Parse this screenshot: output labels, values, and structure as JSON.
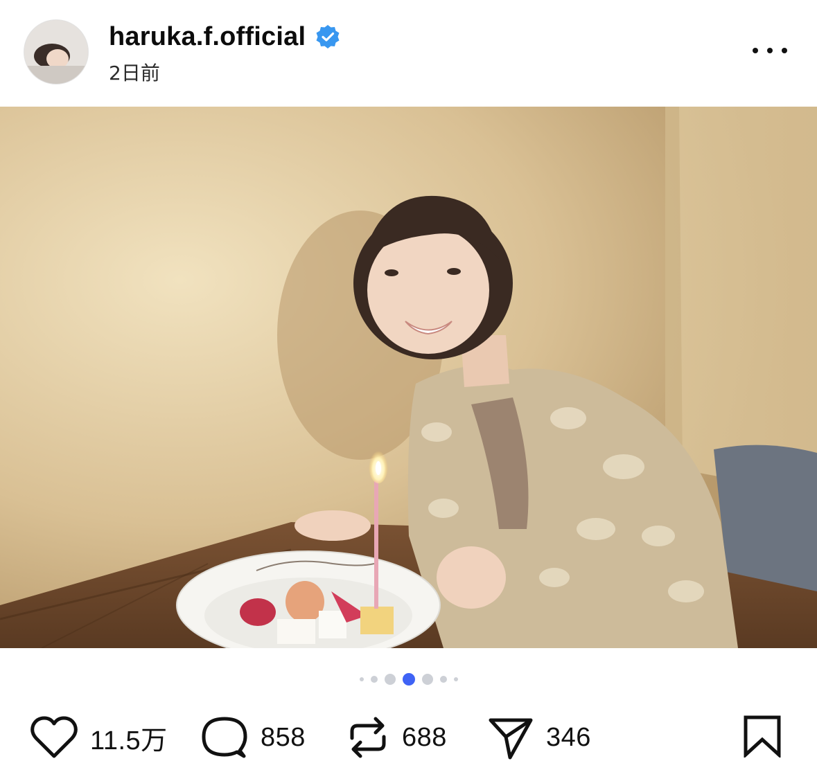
{
  "post": {
    "username": "haruka.f.official",
    "timestamp": "2日前",
    "verified": true,
    "verified_color": "#3897f0",
    "photo_alt_icon": "photo"
  },
  "carousel": {
    "total": 7,
    "active_index": 3,
    "active_color": "#3f63f5",
    "inactive_color": "#cdd0d6"
  },
  "actions": {
    "likes": "11.5万",
    "comments": "858",
    "reposts": "688",
    "shares": "346"
  },
  "icons": {
    "like": "heart-icon",
    "comment": "comment-bubble-icon",
    "repost": "repost-icon",
    "share": "send-icon",
    "bookmark": "bookmark-icon",
    "more": "more-dots-icon"
  }
}
